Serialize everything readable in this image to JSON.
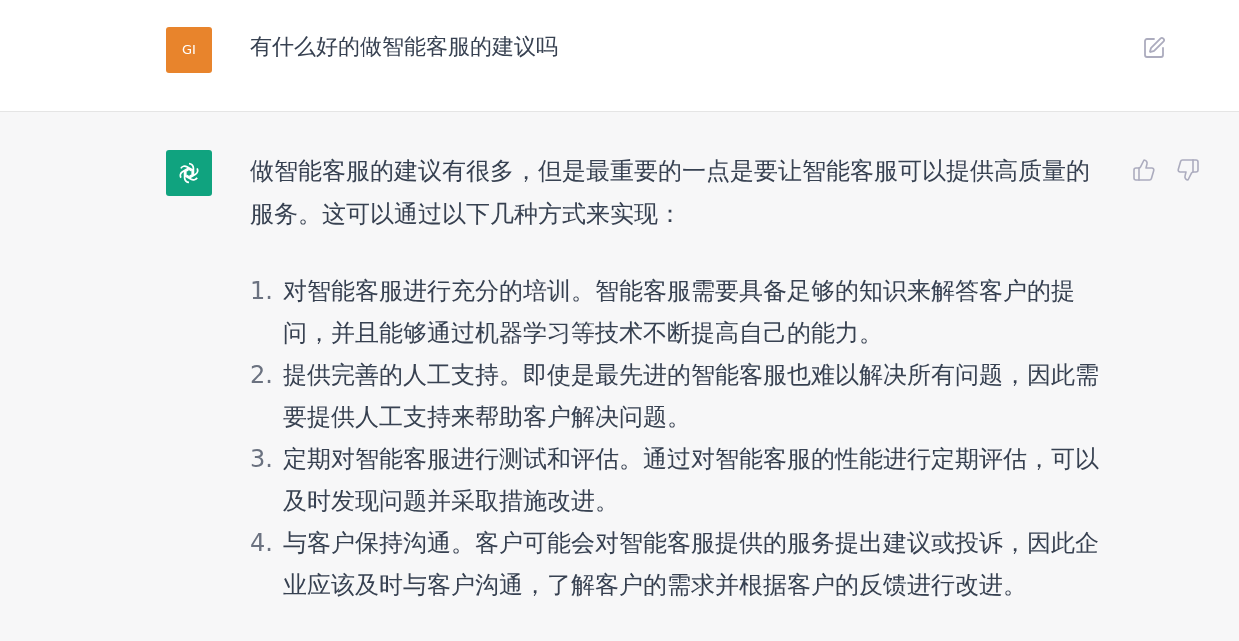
{
  "user_message": {
    "avatar": "GI",
    "text": "有什么好的做智能客服的建议吗"
  },
  "assistant_message": {
    "intro": "做智能客服的建议有很多，但是最重要的一点是要让智能客服可以提供高质量的服务。这可以通过以下几种方式来实现：",
    "items": [
      {
        "number": "1.",
        "text": "对智能客服进行充分的培训。智能客服需要具备足够的知识来解答客户的提问，并且能够通过机器学习等技术不断提高自己的能力。"
      },
      {
        "number": "2.",
        "text": "提供完善的人工支持。即使是最先进的智能客服也难以解决所有问题，因此需要提供人工支持来帮助客户解决问题。"
      },
      {
        "number": "3.",
        "text": "定期对智能客服进行测试和评估。通过对智能客服的性能进行定期评估，可以及时发现问题并采取措施改进。"
      },
      {
        "number": "4.",
        "text": "与客户保持沟通。客户可能会对智能客服提供的服务提出建议或投诉，因此企业应该及时与客户沟通，了解客户的需求并根据客户的反馈进行改进。"
      }
    ]
  }
}
